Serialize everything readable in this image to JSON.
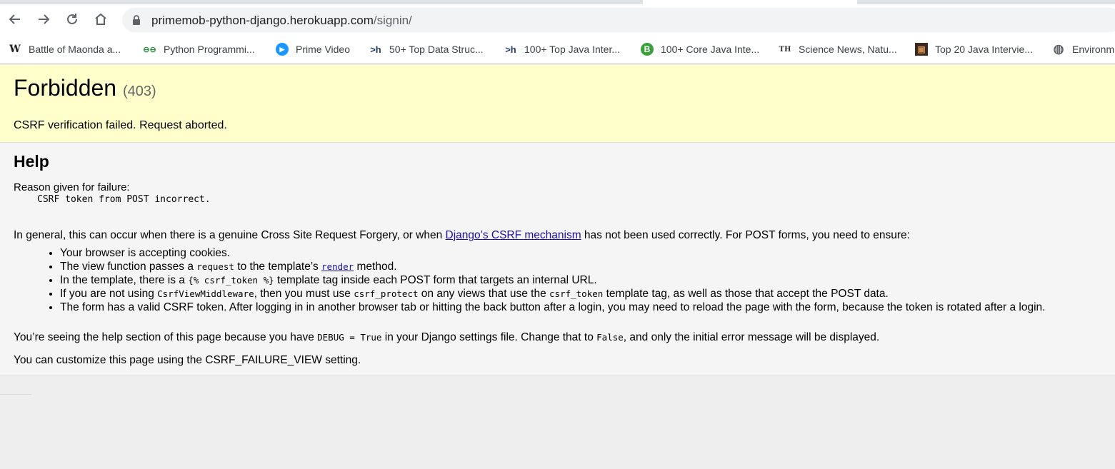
{
  "browser": {
    "url_host": "primemob-python-django.herokuapp.com",
    "url_path": "/signin/"
  },
  "bookmarks": [
    {
      "label": "Battle of Maonda a...",
      "icon": "W",
      "icon_name": "wikipedia-icon"
    },
    {
      "label": "Python Programmi...",
      "icon": "⊖⊖",
      "icon_name": "geeksforgeeks-icon"
    },
    {
      "label": "Prime Video",
      "icon": "▶",
      "icon_name": "prime-video-icon"
    },
    {
      "label": "50+ Top Data Struc...",
      "icon": ">h",
      "icon_name": "hackr-icon"
    },
    {
      "label": "100+ Top Java Inter...",
      "icon": ">h",
      "icon_name": "hackr-icon"
    },
    {
      "label": "100+ Core Java Inte...",
      "icon": "B",
      "icon_name": "b-green-icon"
    },
    {
      "label": "Science News, Natu...",
      "icon": "TH",
      "icon_name": "the-hindu-icon"
    },
    {
      "label": "Top 20 Java Intervie...",
      "icon": "▣",
      "icon_name": "java-book-icon"
    },
    {
      "label": "Environm",
      "icon": "◍",
      "icon_name": "globe-icon"
    }
  ],
  "summary": {
    "title": "Forbidden",
    "status": "(403)",
    "message": "CSRF verification failed. Request aborted."
  },
  "help": {
    "heading": "Help",
    "reason_label": "Reason given for failure:",
    "reason": "CSRF token from POST incorrect.",
    "general_before": "In general, this can occur when there is a genuine Cross Site Request Forgery, or when ",
    "general_link": "Django’s CSRF mechanism",
    "general_after": " has not been used correctly. For POST forms, you need to ensure:",
    "items": {
      "i1": "Your browser is accepting cookies.",
      "i2_a": "The view function passes a ",
      "i2_code": "request",
      "i2_b": " to the template’s ",
      "i2_link": "render",
      "i2_c": " method.",
      "i3_a": "In the template, there is a ",
      "i3_code": "{% csrf_token %}",
      "i3_b": " template tag inside each POST form that targets an internal URL.",
      "i4_a": "If you are not using ",
      "i4_code1": "CsrfViewMiddleware",
      "i4_b": ", then you must use ",
      "i4_code2": "csrf_protect",
      "i4_c": " on any views that use the ",
      "i4_code3": "csrf_token",
      "i4_d": " template tag, as well as those that accept the POST data.",
      "i5": "The form has a valid CSRF token. After logging in in another browser tab or hitting the back button after a login, you may need to reload the page with the form, because the token is rotated after a login."
    },
    "debug_a": "You’re seeing the help section of this page because you have ",
    "debug_code1": "DEBUG = True",
    "debug_b": " in your Django settings file. Change that to ",
    "debug_code2": "False",
    "debug_c": ", and only the initial error message will be displayed.",
    "customize": "You can customize this page using the CSRF_FAILURE_VIEW setting."
  }
}
